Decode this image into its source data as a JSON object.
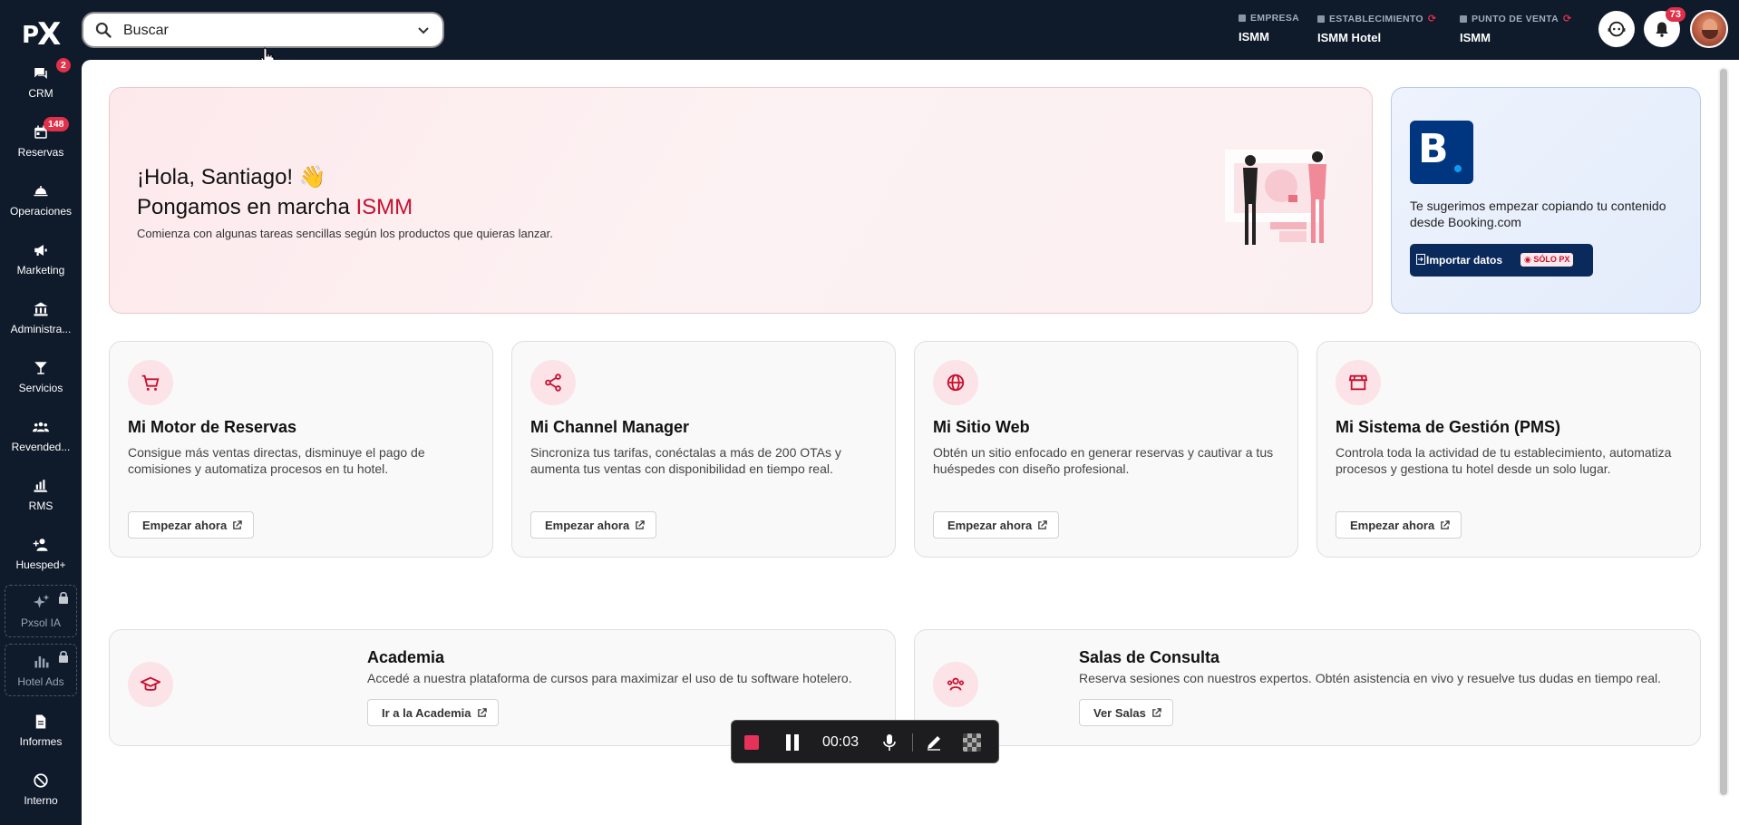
{
  "logo": {
    "p": "P",
    "x": "X"
  },
  "search": {
    "placeholder": "Buscar"
  },
  "context": {
    "empresa": {
      "label": "EMPRESA",
      "value": "ISMM"
    },
    "establecimiento": {
      "label": "ESTABLECIMIENTO",
      "value": "ISMM Hotel"
    },
    "punto_venta": {
      "label": "PUNTO DE VENTA",
      "value": "ISMM"
    }
  },
  "notifications": {
    "count": "73"
  },
  "sidebar": {
    "items": [
      {
        "label": "CRM",
        "badge": "2",
        "icon": "chat-icon"
      },
      {
        "label": "Reservas",
        "badge": "148",
        "icon": "calendar-icon"
      },
      {
        "label": "Operaciones",
        "icon": "bell-service-icon"
      },
      {
        "label": "Marketing",
        "icon": "megaphone-icon"
      },
      {
        "label": "Administra...",
        "icon": "bank-icon"
      },
      {
        "label": "Servicios",
        "icon": "cocktail-icon"
      },
      {
        "label": "Revended...",
        "icon": "group-icon"
      },
      {
        "label": "RMS",
        "icon": "chart-hand-icon"
      },
      {
        "label": "Huesped+",
        "icon": "person-add-icon"
      },
      {
        "label": "Pxsol IA",
        "icon": "sparkles-icon",
        "locked": true
      },
      {
        "label": "Hotel Ads",
        "icon": "bar-chart-icon",
        "locked": true
      },
      {
        "label": "Informes",
        "icon": "document-icon"
      },
      {
        "label": "Interno",
        "icon": "block-icon"
      }
    ]
  },
  "hero": {
    "greeting": "¡Hola, Santiago! 👋",
    "title_prefix": "Pongamos en marcha ",
    "title_brand": "ISMM",
    "subtitle": "Comienza con algunas tareas sencillas según los productos que quieras lanzar."
  },
  "booking": {
    "logo_letter": "B",
    "text": "Te sugerimos empezar copiando tu contenido desde Booking.com",
    "button_label": "Importar datos",
    "pill": "SÓLO PX"
  },
  "cards": [
    {
      "title": "Mi Motor de Reservas",
      "desc": "Consigue más ventas directas, disminuye el pago de comisiones y automatiza procesos en tu hotel.",
      "button": "Empezar ahora"
    },
    {
      "title": "Mi Channel Manager",
      "desc": "Sincroniza tus tarifas, conéctalas a más de 200 OTAs y aumenta tus ventas con disponibilidad en tiempo real.",
      "button": "Empezar ahora"
    },
    {
      "title": "Mi Sitio Web",
      "desc": "Obtén un sitio enfocado en generar reservas y cautivar a tus huéspedes con diseño profesional.",
      "button": "Empezar ahora"
    },
    {
      "title": "Mi Sistema de Gestión (PMS)",
      "desc": "Controla toda la actividad de tu establecimiento, automatiza procesos y gestiona tu hotel desde un solo lugar.",
      "button": "Empezar ahora"
    }
  ],
  "academia": {
    "title": "Academia",
    "desc": "Accedé a nuestra plataforma de cursos para maximizar el uso de tu software hotelero.",
    "button": "Ir a la Academia"
  },
  "salas": {
    "title": "Salas de Consulta",
    "desc": "Reserva sesiones con nuestros expertos. Obtén asistencia en vivo y resuelve tus dudas en tiempo real.",
    "button": "Ver Salas"
  },
  "recorder": {
    "time": "00:03"
  },
  "colors": {
    "brand": "#c8102e",
    "nav": "#0f1a2b",
    "badge": "#e0304a",
    "booking": "#003580"
  }
}
